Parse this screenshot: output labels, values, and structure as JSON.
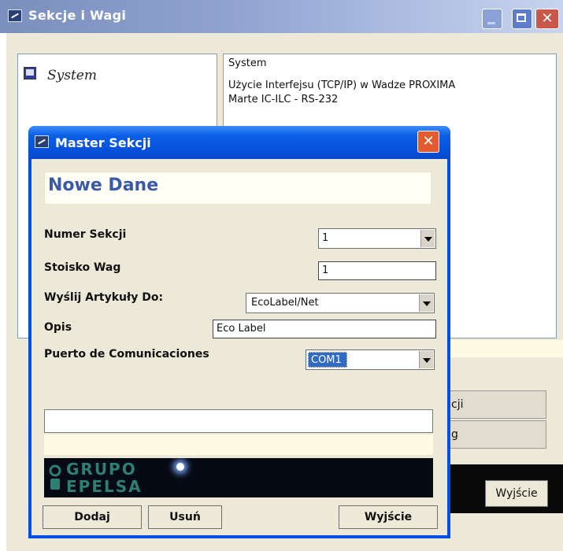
{
  "outer_window": {
    "title": "Sekcje i Wagi",
    "tree_item": "System",
    "description_lines": [
      "System",
      "Użycie Interfejsu (TCP/IP) w Wadze PROXIMA",
      "Marte IC-ILC - RS-232"
    ],
    "right_button_1": "cji",
    "right_button_2": "g",
    "exit_button": "Wyjście"
  },
  "dialog": {
    "title": "Master Sekcji",
    "header": "Nowe Dane",
    "fields": {
      "numer_sekcji": {
        "label": "Numer Sekcji",
        "value": "1"
      },
      "stoisko_wag": {
        "label": "Stoisko Wag",
        "value": "1"
      },
      "wyslij_artykuly": {
        "label": "Wyślij Artykuły Do:",
        "value": "EcoLabel/Net"
      },
      "opis": {
        "label": "Opis",
        "value": "Eco Label"
      },
      "puerto": {
        "label": "Puerto de Comunicaciones",
        "value": "COM1"
      }
    },
    "logo": {
      "line1": "GRUPO",
      "line2": "EPELSA"
    },
    "buttons": {
      "add": "Dodaj",
      "delete": "Usuń",
      "exit": "Wyjście"
    }
  },
  "colors": {
    "dialog_header_text": "#3a59a8",
    "xp_blue": "#0050e6",
    "selection": "#316ac5"
  }
}
